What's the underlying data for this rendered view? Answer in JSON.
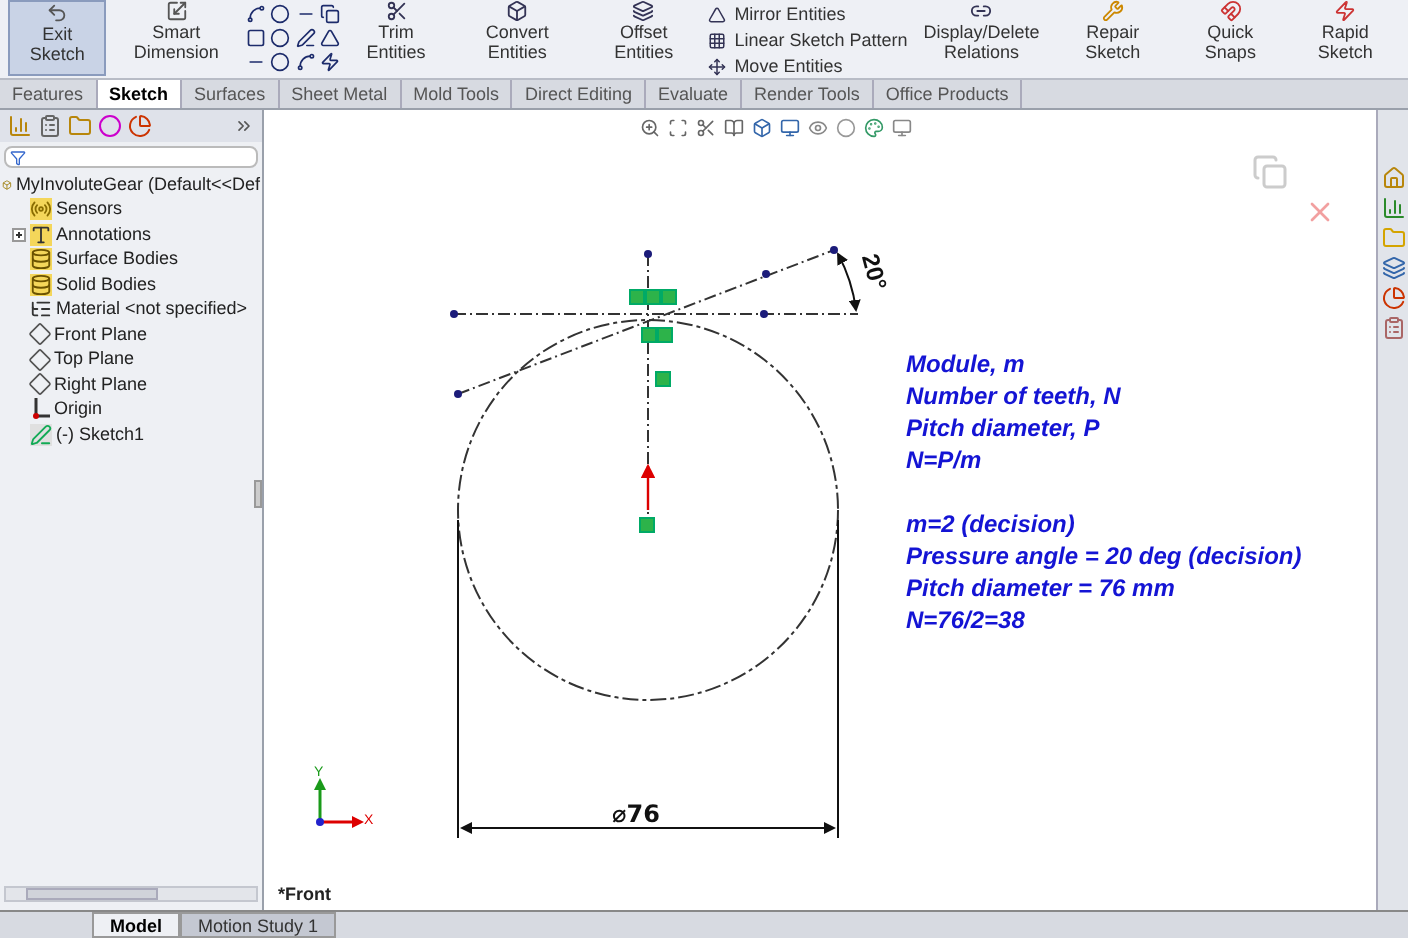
{
  "ribbon": {
    "left_buttons": [
      {
        "label": "Exit Sketch",
        "selected": true
      },
      {
        "label": "Smart Dimension",
        "selected": false
      }
    ],
    "mid_buttons": [
      {
        "label": "Trim Entities",
        "selected": false
      },
      {
        "label": "Convert Entities",
        "selected": false
      },
      {
        "label": "Offset Entities",
        "selected": false
      }
    ],
    "list_items": [
      "Mirror Entities",
      "Linear Sketch Pattern",
      "Move Entities"
    ],
    "right_buttons": [
      {
        "label": "Display/Delete Relations",
        "selected": false
      },
      {
        "label": "Repair Sketch",
        "selected": false
      },
      {
        "label": "Quick Snaps",
        "selected": false
      },
      {
        "label": "Rapid Sketch",
        "selected": false
      }
    ]
  },
  "command_tabs": [
    {
      "label": "Features",
      "selected": false
    },
    {
      "label": "Sketch",
      "selected": true
    },
    {
      "label": "Surfaces",
      "selected": false
    },
    {
      "label": "Sheet Metal",
      "selected": false
    },
    {
      "label": "Mold Tools",
      "selected": false
    },
    {
      "label": "Direct Editing",
      "selected": false
    },
    {
      "label": "Evaluate",
      "selected": false
    },
    {
      "label": "Render Tools",
      "selected": false
    },
    {
      "label": "Office Products",
      "selected": false
    }
  ],
  "feature_tree": {
    "root": "MyInvoluteGear  (Default<<Def",
    "items": [
      {
        "label": "Sensors",
        "kind": "sensors",
        "collapsed": false
      },
      {
        "label": "Annotations",
        "kind": "annotations",
        "collapsed": true
      },
      {
        "label": "Surface Bodies",
        "kind": "bodies",
        "collapsed": false
      },
      {
        "label": "Solid Bodies",
        "kind": "bodies",
        "collapsed": false
      },
      {
        "label": "Material <not specified>",
        "kind": "material",
        "collapsed": false
      },
      {
        "label": "Front Plane",
        "kind": "plane",
        "collapsed": false
      },
      {
        "label": "Top Plane",
        "kind": "plane",
        "collapsed": false
      },
      {
        "label": "Right Plane",
        "kind": "plane",
        "collapsed": false
      },
      {
        "label": "Origin",
        "kind": "origin",
        "collapsed": false
      },
      {
        "label": "(-) Sketch1",
        "kind": "sketch",
        "collapsed": false
      }
    ]
  },
  "canvas": {
    "angle_dimension": "20°",
    "diameter_dimension": "⌀76",
    "view_label": "*Front",
    "triad": {
      "x": "X",
      "y": "Y"
    },
    "notes": [
      {
        "lines": [
          "Module, m",
          "Number of teeth, N",
          "Pitch diameter, P",
          "N=P/m"
        ]
      },
      {
        "lines": [
          "m=2 (decision)",
          "Pressure angle = 20 deg (decision)",
          "Pitch diameter = 76 mm",
          "N=76/2=38"
        ]
      }
    ]
  },
  "bottom_tabs": [
    {
      "label": "Model",
      "selected": true
    },
    {
      "label": "Motion Study 1",
      "selected": false
    }
  ]
}
